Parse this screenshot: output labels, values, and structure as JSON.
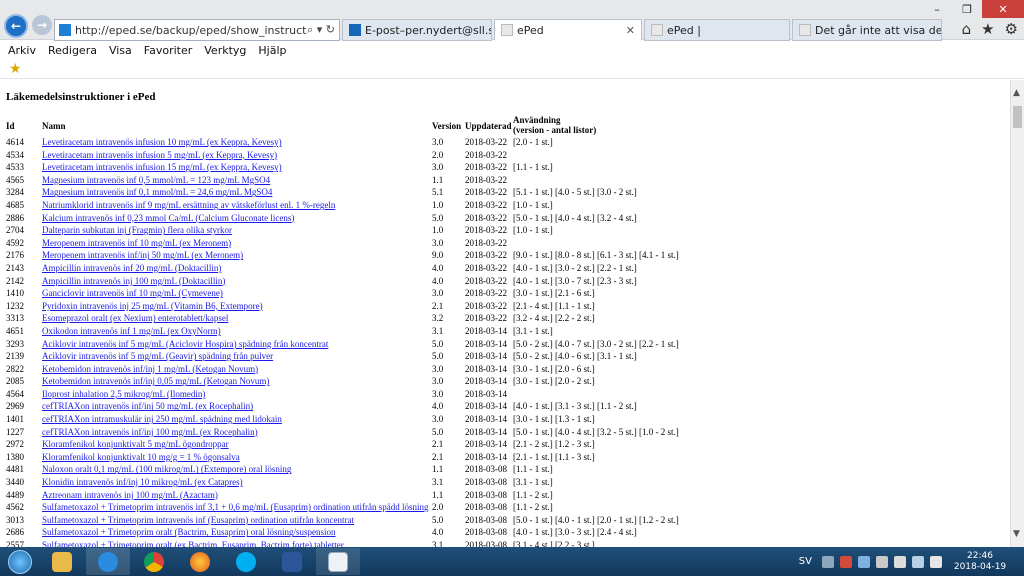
{
  "browser": {
    "url": "http://eped.se/backup/eped/show_instructions.html",
    "address_tools": "⌕ ▾ ↻",
    "tabs": [
      {
        "label": "E-post–per.nydert@sll.se"
      },
      {
        "label": "ePed"
      },
      {
        "label": "ePed |"
      },
      {
        "label": "Det går inte att visa den här sid..."
      }
    ],
    "tab_close_glyph": "✕",
    "window_controls": {
      "minimize": "–",
      "maximize": "❐",
      "close": "✕"
    },
    "right_icons": {
      "home": "⌂",
      "favorites": "★",
      "settings": "⚙"
    }
  },
  "menu": [
    "Arkiv",
    "Redigera",
    "Visa",
    "Favoriter",
    "Verktyg",
    "Hjälp"
  ],
  "page": {
    "title": "Läkemedelsinstruktioner i ePed",
    "headers": {
      "id": "Id",
      "name": "Namn",
      "version": "Version",
      "updated": "Uppdaterad",
      "usage_line1": "Användning",
      "usage_line2": "(version - antal listor)"
    },
    "rows": [
      {
        "id": "4614",
        "name": "Levetiracetam intravenös infusion 10 mg/mL (ex Keppra, Kevesy)",
        "version": "3.0",
        "updated": "2018-03-22",
        "usage": "[2.0 - 1 st.]"
      },
      {
        "id": "4534",
        "name": "Levetiracetam intravenös infusion 5 mg/mL (ex Keppra, Kevesy)",
        "version": "2.0",
        "updated": "2018-03-22",
        "usage": ""
      },
      {
        "id": "4533",
        "name": "Levetiracetam intravenös infusion 15 mg/mL (ex Keppra, Kevesy)",
        "version": "3.0",
        "updated": "2018-03-22",
        "usage": "[1.1 - 1 st.]"
      },
      {
        "id": "4565",
        "name": "Magnesium intravenös inf 0,5 mmol/mL = 123 mg/mL MgSO4",
        "version": "1.1",
        "updated": "2018-03-22",
        "usage": ""
      },
      {
        "id": "3284",
        "name": "Magnesium intravenös inf 0,1 mmol/mL = 24,6 mg/mL MgSO4",
        "version": "5.1",
        "updated": "2018-03-22",
        "usage": "[5.1 - 1 st.] [4.0 - 5 st.] [3.0 - 2 st.]"
      },
      {
        "id": "4685",
        "name": "Natriumklorid intravenös inf 9 mg/mL ersättning av vätskeförlust enl. 1 %-regeln",
        "version": "1.0",
        "updated": "2018-03-22",
        "usage": "[1.0 - 1 st.]"
      },
      {
        "id": "2886",
        "name": "Kalcium intravenös inf 0,23 mmol Ca/mL (Calcium Gluconate licens)",
        "version": "5.0",
        "updated": "2018-03-22",
        "usage": "[5.0 - 1 st.] [4.0 - 4 st.] [3.2 - 4 st.]"
      },
      {
        "id": "2704",
        "name": "Dalteparin subkutan inj (Fragmin) flera olika styrkor",
        "version": "1.0",
        "updated": "2018-03-22",
        "usage": "[1.0 - 1 st.]"
      },
      {
        "id": "4592",
        "name": "Meropenem intravenös inf 10 mg/mL (ex Meronem)",
        "version": "3.0",
        "updated": "2018-03-22",
        "usage": ""
      },
      {
        "id": "2176",
        "name": "Meropenem intravenös inf/inj 50 mg/mL (ex Meronem)",
        "version": "9.0",
        "updated": "2018-03-22",
        "usage": "[9.0 - 1 st.] [8.0 - 8 st.] [6.1 - 3 st.] [4.1 - 1 st.]"
      },
      {
        "id": "2143",
        "name": "Ampicillin intravenös inf 20 mg/mL (Doktacillin)",
        "version": "4.0",
        "updated": "2018-03-22",
        "usage": "[4.0 - 1 st.] [3.0 - 2 st.] [2.2 - 1 st.]"
      },
      {
        "id": "2142",
        "name": "Ampicillin intravenös inj 100 mg/mL (Doktacillin)",
        "version": "4.0",
        "updated": "2018-03-22",
        "usage": "[4.0 - 1 st.] [3.0 - 7 st.] [2.3 - 3 st.]"
      },
      {
        "id": "1410",
        "name": "Ganciclovir intravenös inf 10 mg/mL (Cymevene)",
        "version": "3.0",
        "updated": "2018-03-22",
        "usage": "[3.0 - 1 st.] [2.1 - 6 st.]"
      },
      {
        "id": "1232",
        "name": "Pyridoxin intravenös inj 25 mg/mL (Vitamin B6, Extempore)",
        "version": "2.1",
        "updated": "2018-03-22",
        "usage": "[2.1 - 4 st.] [1.1 - 1 st.]"
      },
      {
        "id": "3313",
        "name": "Esomeprazol oralt (ex Nexium) enterotablett/kapsel",
        "version": "3.2",
        "updated": "2018-03-22",
        "usage": "[3.2 - 4 st.] [2.2 - 2 st.]"
      },
      {
        "id": "4651",
        "name": "Oxikodon intravenös inf 1 mg/mL (ex OxyNorm)",
        "version": "3.1",
        "updated": "2018-03-14",
        "usage": "[3.1 - 1 st.]"
      },
      {
        "id": "3293",
        "name": "Aciklovir intravenös inf 5 mg/mL (Aciclovir Hospira) spädning från koncentrat",
        "version": "5.0",
        "updated": "2018-03-14",
        "usage": "[5.0 - 2 st.] [4.0 - 7 st.] [3.0 - 2 st.] [2.2 - 1 st.]"
      },
      {
        "id": "2139",
        "name": "Aciklovir intravenös inf 5 mg/mL (Geavir) spädning från pulver",
        "version": "5.0",
        "updated": "2018-03-14",
        "usage": "[5.0 - 2 st.] [4.0 - 6 st.] [3.1 - 1 st.]"
      },
      {
        "id": "2822",
        "name": "Ketobemidon intravenös inf/inj 1 mg/mL (Ketogan Novum)",
        "version": "3.0",
        "updated": "2018-03-14",
        "usage": "[3.0 - 1 st.] [2.0 - 6 st.]"
      },
      {
        "id": "2085",
        "name": "Ketobemidon intravenös inf/inj 0,05 mg/mL (Ketogan Novum)",
        "version": "3.0",
        "updated": "2018-03-14",
        "usage": "[3.0 - 1 st.] [2.0 - 2 st.]"
      },
      {
        "id": "4564",
        "name": "Iloprost inhalation 2,5 mikrog/mL (Ilomedin)",
        "version": "3.0",
        "updated": "2018-03-14",
        "usage": ""
      },
      {
        "id": "2969",
        "name": "cefTRIAXon intravenös inf/inj 50 mg/mL (ex Rocephalin)",
        "version": "4.0",
        "updated": "2018-03-14",
        "usage": "[4.0 - 1 st.] [3.1 - 3 st.] [1.1 - 2 st.]"
      },
      {
        "id": "1401",
        "name": "cefTRIAXon intramuskulär inj 250 mg/mL spädning med lidokain",
        "version": "3.0",
        "updated": "2018-03-14",
        "usage": "[3.0 - 1 st.] [1.3 - 1 st.]"
      },
      {
        "id": "1227",
        "name": "cefTRIAXon intravenös inf/inj 100 mg/mL (ex Rocephalin)",
        "version": "5.0",
        "updated": "2018-03-14",
        "usage": "[5.0 - 1 st.] [4.0 - 4 st.] [3.2 - 5 st.] [1.0 - 2 st.]"
      },
      {
        "id": "2972",
        "name": "Kloramfenikol konjunktivalt 5 mg/mL ögondroppar",
        "version": "2.1",
        "updated": "2018-03-14",
        "usage": "[2.1 - 2 st.] [1.2 - 3 st.]"
      },
      {
        "id": "1380",
        "name": "Kloramfenikol konjunktivalt 10 mg/g = 1 % ögonsalva",
        "version": "2.1",
        "updated": "2018-03-14",
        "usage": "[2.1 - 1 st.] [1.1 - 3 st.]"
      },
      {
        "id": "4481",
        "name": "Naloxon oralt 0,1 mg/mL (100 mikrog/mL) (Extempore) oral lösning",
        "version": "1.1",
        "updated": "2018-03-08",
        "usage": "[1.1 - 1 st.]"
      },
      {
        "id": "3440",
        "name": "Klonidin intravenös inf/inj 10 mikrog/mL (ex Catapres)",
        "version": "3.1",
        "updated": "2018-03-08",
        "usage": "[3.1 - 1 st.]"
      },
      {
        "id": "4489",
        "name": "Aztreonam intravenös inj 100 mg/mL (Azactam)",
        "version": "1.1",
        "updated": "2018-03-08",
        "usage": "[1.1 - 2 st.]"
      },
      {
        "id": "4562",
        "name": "Sulfametoxazol + Trimetoprim intravenös inf 3,1 + 0,6 mg/mL (Eusaprim) ordination utifrån spädd lösning",
        "version": "2.0",
        "updated": "2018-03-08",
        "usage": "[1.1 - 2 st.]"
      },
      {
        "id": "3013",
        "name": "Sulfametoxazol + Trimetoprim intravenös inf (Eusaprim) ordination utifrån koncentrat",
        "version": "5.0",
        "updated": "2018-03-08",
        "usage": "[5.0 - 1 st.] [4.0 - 1 st.] [2.0 - 1 st.] [1.2 - 2 st.]"
      },
      {
        "id": "2686",
        "name": "Sulfametoxazol + Trimetoprim oralt (Bactrim, Eusaprim) oral lösning/suspension",
        "version": "4.0",
        "updated": "2018-03-08",
        "usage": "[4.0 - 1 st.] [3.0 - 3 st.] [2.4 - 4 st.]"
      },
      {
        "id": "2557",
        "name": "Sulfametoxazol + Trimetoprim oralt (ex Bactrim, Eusaprim, Bactrim forte) tabletter",
        "version": "3.1",
        "updated": "2018-03-08",
        "usage": "[3.1 - 4 st.] [2.2 - 3 st.]"
      }
    ]
  },
  "taskbar": {
    "language": "SV",
    "time": "22:46",
    "date": "2018-04-19",
    "apps": [
      "file-explorer",
      "internet-explorer",
      "chrome",
      "firefox",
      "skype",
      "word",
      "nav"
    ]
  }
}
